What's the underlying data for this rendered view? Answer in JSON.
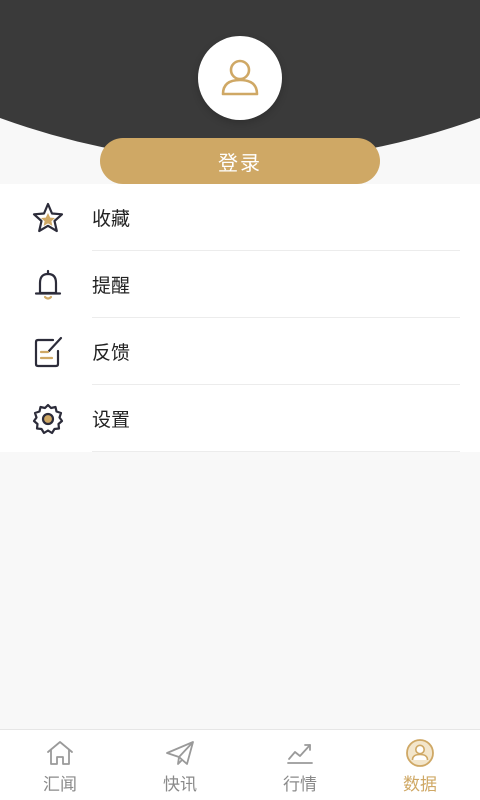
{
  "colors": {
    "header_bg": "#3a3a3a",
    "accent": "#cfa865",
    "icon_dark": "#2c2c3a",
    "tab_inactive": "#8a8a8a"
  },
  "profile": {
    "avatar_icon": "user-outline-icon",
    "login_label": "登录"
  },
  "menu": {
    "items": [
      {
        "label": "收藏",
        "icon": "star-icon"
      },
      {
        "label": "提醒",
        "icon": "bell-icon"
      },
      {
        "label": "反馈",
        "icon": "feedback-edit-icon"
      },
      {
        "label": "设置",
        "icon": "gear-icon"
      }
    ]
  },
  "tabbar": {
    "active_index": 3,
    "tabs": [
      {
        "label": "汇闻",
        "icon": "home-icon"
      },
      {
        "label": "快讯",
        "icon": "paper-plane-icon"
      },
      {
        "label": "行情",
        "icon": "chart-trend-icon"
      },
      {
        "label": "数据",
        "icon": "user-circle-icon"
      }
    ]
  }
}
